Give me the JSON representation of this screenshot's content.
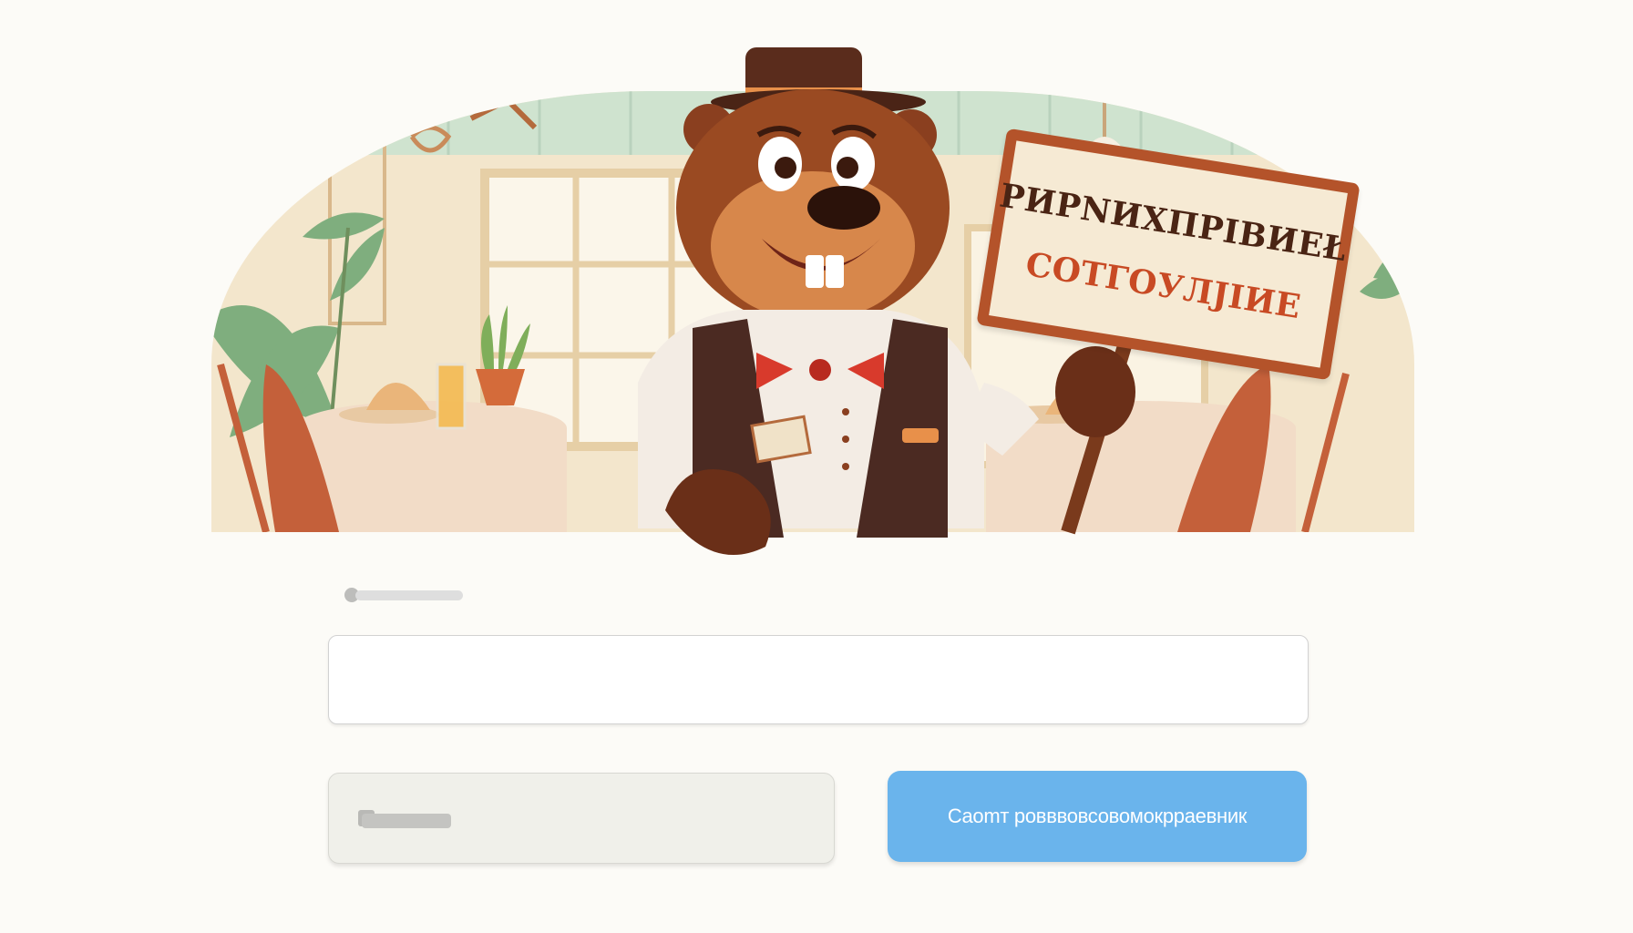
{
  "hero": {
    "sign_line_1": "PИРNИХПРІВИEŁ",
    "sign_line_2": "COTГOУЛJIИE"
  },
  "form": {
    "input_value": "",
    "input_placeholder": "",
    "primary_button_label": "Сaomт poвввовсовомокрраевник"
  },
  "colors": {
    "primary": "#6ab4ec",
    "background": "#fcfbf7",
    "beaver_fur": "#9a4a22",
    "sign_border": "#b4532a"
  }
}
